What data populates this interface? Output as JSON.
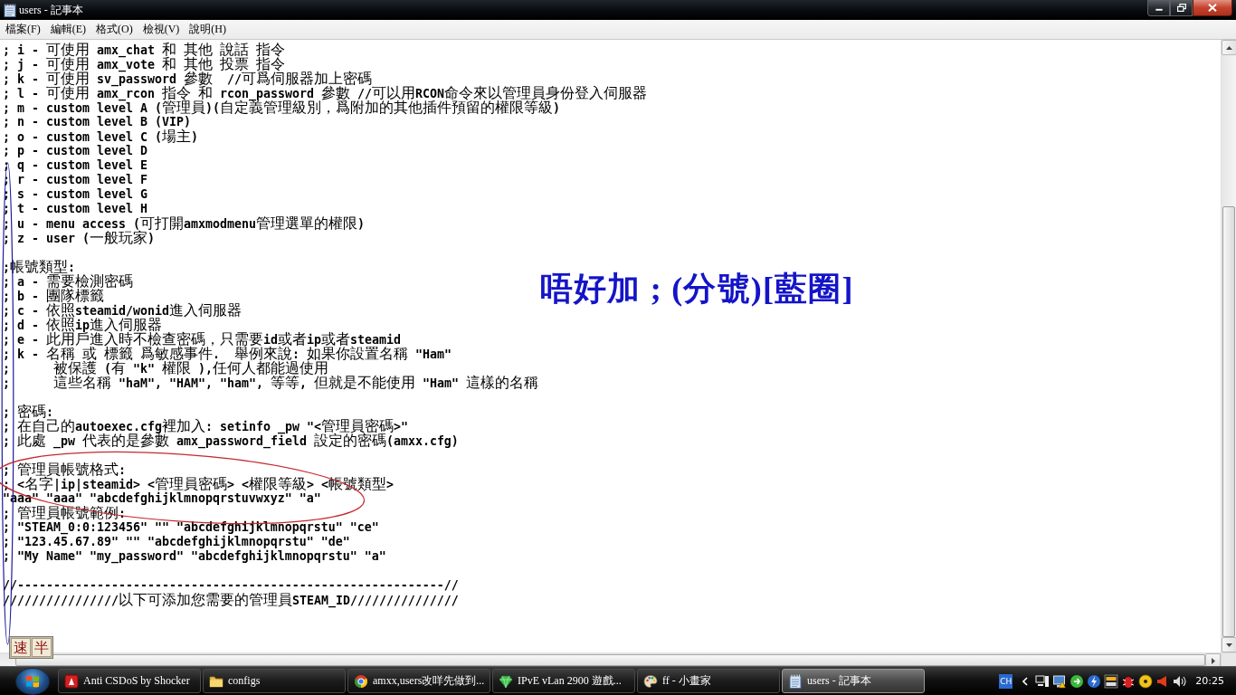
{
  "window": {
    "title": "users - 記事本"
  },
  "menu": [
    "檔案(F)",
    "編輯(E)",
    "格式(O)",
    "檢視(V)",
    "說明(H)"
  ],
  "editor": {
    "blocks": [
      {
        "lines": [
          "; i - 可使用 amx_chat 和 其他 說話 指令",
          "; j - 可使用 amx_vote 和 其他 投票 指令",
          "; k - 可使用 sv_password 參數  //可爲伺服器加上密碼",
          "; l - 可使用 amx_rcon 指令 和 rcon_password 參數 //可以用RCON命令來以管理員身份登入伺服器",
          "; m - custom level A (管理員)(自定義管理級別，爲附加的其他插件預留的權限等級)",
          "; n - custom level B (VIP)",
          "; o - custom level C (場主)",
          "; p - custom level D",
          "; q - custom level E",
          "; r - custom level F",
          "; s - custom level G",
          "; t - custom level H",
          "; u - menu access (可打開amxmodmenu管理選單的權限)",
          "; z - user (一般玩家)"
        ]
      },
      {
        "lines": [
          ";帳號類型:",
          "; a - 需要檢測密碼",
          "; b - 團隊標籤",
          "; c - 依照steamid/wonid進入伺服器",
          "; d - 依照ip進入伺服器",
          "; e - 此用戶進入時不檢查密碼，只需要id或者ip或者steamid",
          "; k - 名稱 或 標籤 爲敏感事件.  舉例來說: 如果你設置名稱 \"Ham\"",
          ";      被保護 (有 \"k\" 權限 ),任何人都能過使用",
          ";      這些名稱 \"haM\", \"HAM\", \"ham\", 等等, 但就是不能使用 \"Ham\" 這樣的名稱"
        ]
      },
      {
        "lines": [
          "; 密碼:",
          "; 在自己的autoexec.cfg裡加入: setinfo _pw \"<管理員密碼>\"",
          "; 此處 _pw 代表的是參數 amx_password_field 設定的密碼(amxx.cfg)"
        ]
      },
      {
        "lines": [
          "; 管理員帳號格式:",
          "; <名字|ip|steamid> <管理員密碼> <權限等級> <帳號類型>",
          "\"aaa\" \"aaa\" \"abcdefghijklmnopqrstuvwxyz\" \"a\"",
          "; 管理員帳號範例:",
          "; \"STEAM_0:0:123456\" \"\" \"abcdefghijklmnopqrstu\" \"ce\"",
          "; \"123.45.67.89\" \"\" \"abcdefghijklmnopqrstu\" \"de\"",
          "; \"My Name\" \"my_password\" \"abcdefghijklmnopqrstu\" \"a\""
        ]
      },
      {
        "lines": [
          "//-----------------------------------------------------------//",
          "////////////////以下可添加您需要的管理員STEAM_ID///////////////"
        ]
      }
    ]
  },
  "annotation": {
    "text": "唔好加 ; (分號)[藍圈]"
  },
  "ime_bar": {
    "buttons": [
      "速",
      "半"
    ]
  },
  "taskbar": {
    "buttons": [
      {
        "label": "Anti CSDoS by Shocker",
        "kind": "app",
        "selected": false
      },
      {
        "label": "configs",
        "kind": "folder",
        "selected": false
      },
      {
        "label": "amxx,users改咩先做到...",
        "kind": "browser",
        "selected": false
      },
      {
        "label": "IPvE vLan 2900 遊戲...",
        "kind": "gem",
        "selected": false
      },
      {
        "label": "ff - 小畫家",
        "kind": "paint",
        "selected": false
      },
      {
        "label": "users - 記事本",
        "kind": "notepad",
        "selected": true
      }
    ],
    "tray": {
      "language": "CH",
      "clock": "20:25"
    }
  }
}
